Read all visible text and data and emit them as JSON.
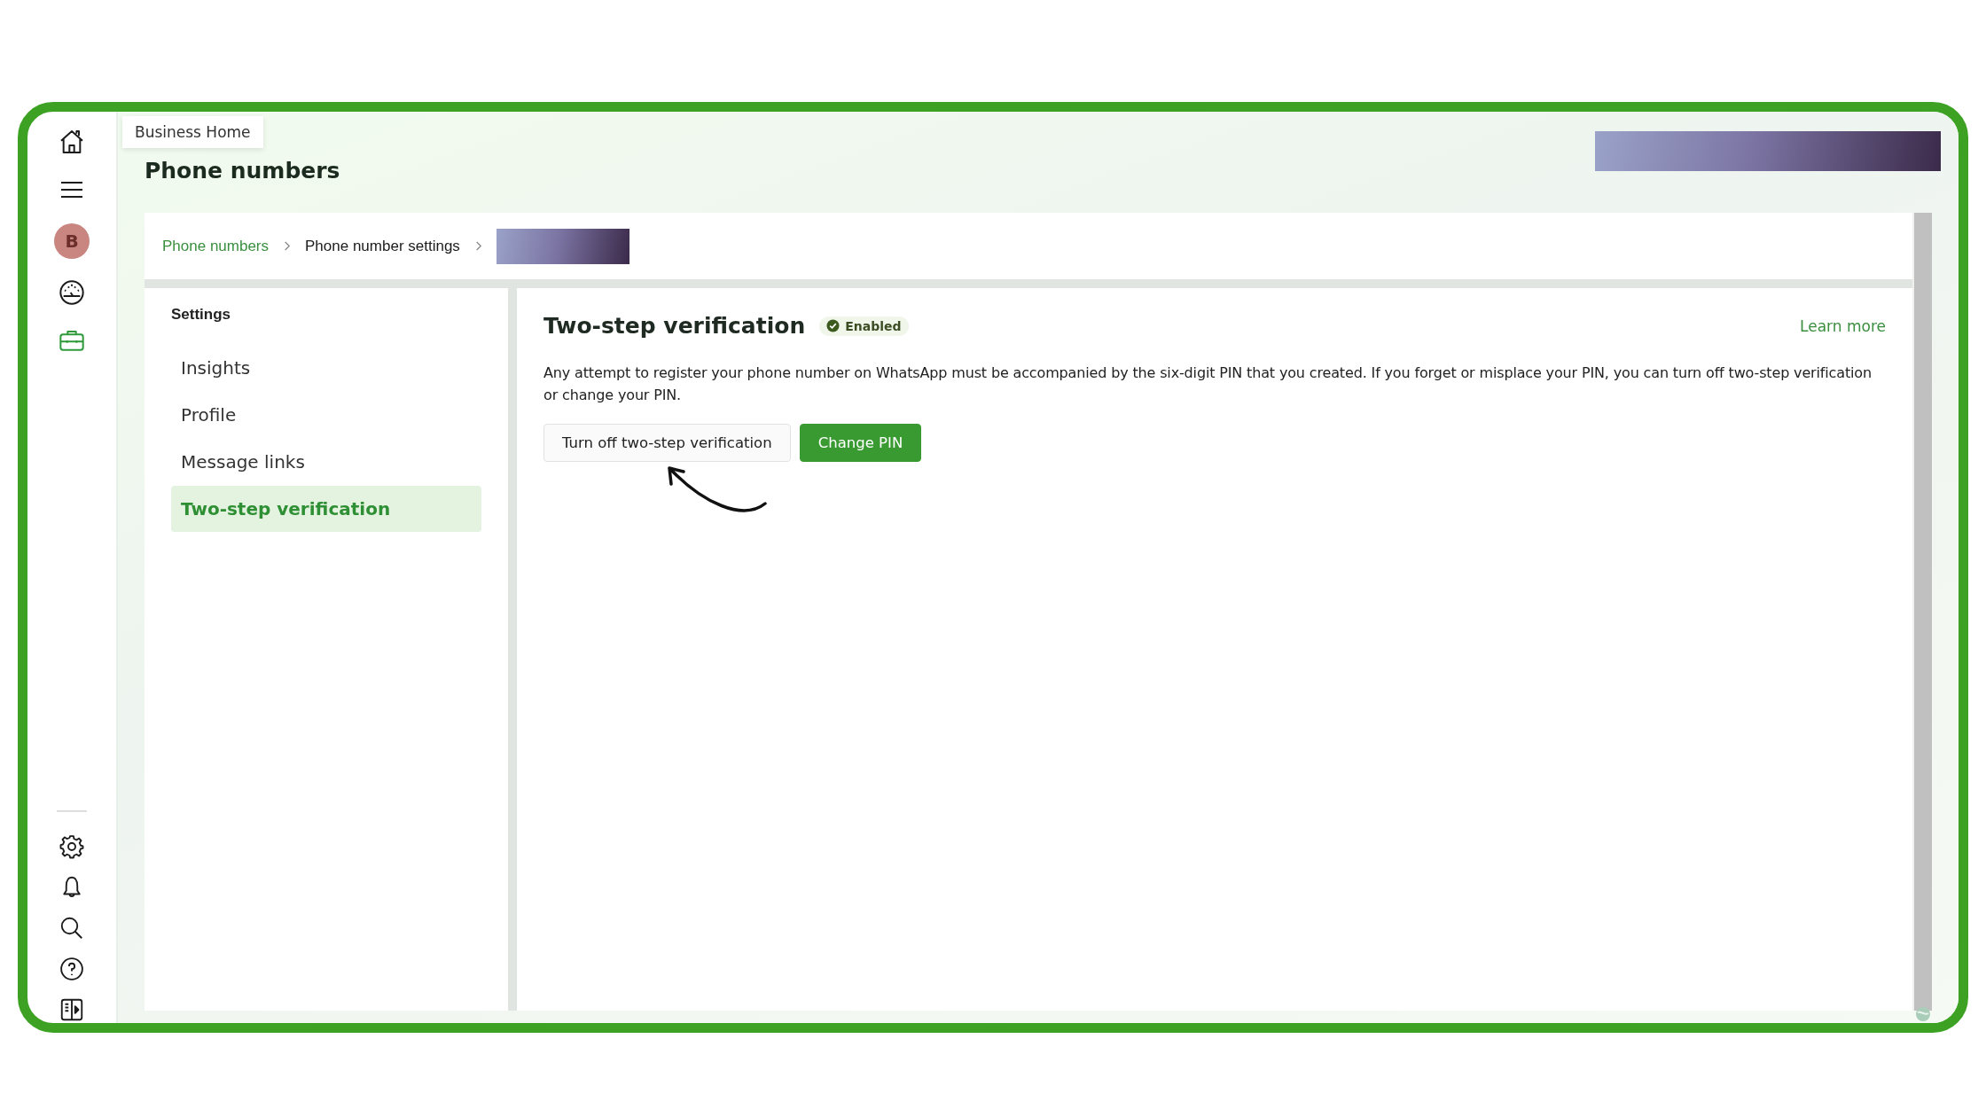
{
  "rail": {
    "top": [
      {
        "kind": "home",
        "selected": false
      },
      {
        "kind": "menu",
        "selected": false
      },
      {
        "kind": "avatar",
        "label": "B",
        "selected": false
      },
      {
        "kind": "gauge",
        "selected": false
      },
      {
        "kind": "briefcase",
        "selected": true
      }
    ],
    "bottom": [
      {
        "kind": "gear"
      },
      {
        "kind": "bell"
      },
      {
        "kind": "search"
      },
      {
        "kind": "help"
      },
      {
        "kind": "panel"
      }
    ]
  },
  "tooltip": "Business Home",
  "page_title": "Phone numbers",
  "breadcrumb": [
    {
      "label": "Phone numbers",
      "link": true
    },
    {
      "label": "Phone number settings",
      "link": false
    }
  ],
  "settings_nav": {
    "title": "Settings",
    "items": [
      {
        "label": "Insights",
        "selected": false
      },
      {
        "label": "Profile",
        "selected": false
      },
      {
        "label": "Message links",
        "selected": false
      },
      {
        "label": "Two-step verification",
        "selected": true
      }
    ]
  },
  "section": {
    "title": "Two-step verification",
    "status": "Enabled",
    "learn_more": "Learn more",
    "description": "Any attempt to register your phone number on WhatsApp must be accompanied by the six-digit PIN that you created. If you forget or misplace your PIN, you can turn off two-step verification or change your PIN.",
    "buttons": [
      {
        "label": "Turn off two-step verification",
        "kind": "secondary"
      },
      {
        "label": "Change PIN",
        "kind": "primary"
      }
    ]
  }
}
